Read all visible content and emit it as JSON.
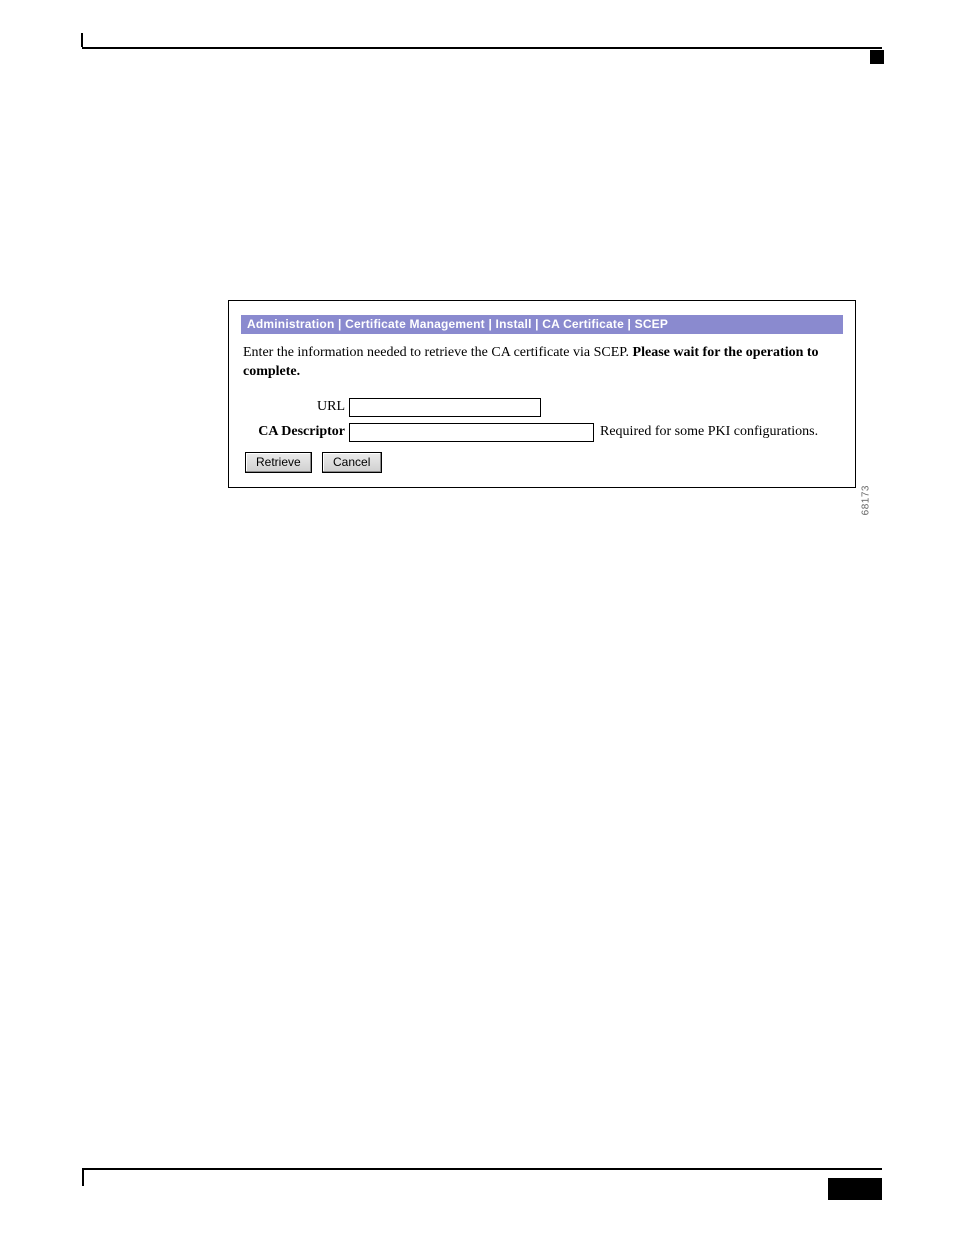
{
  "breadcrumb": {
    "parts": [
      "Administration",
      "Certificate Management",
      "Install",
      "CA Certificate",
      "SCEP"
    ],
    "separator": " | "
  },
  "intro": {
    "lead": "Enter the information needed to retrieve the CA certificate via SCEP. ",
    "bold": "Please wait for the operation to complete."
  },
  "form": {
    "url": {
      "label": "URL",
      "value": ""
    },
    "ca_descriptor": {
      "label": "CA Descriptor",
      "value": "",
      "hint": "Required for some PKI configurations."
    }
  },
  "buttons": {
    "retrieve": "Retrieve",
    "cancel": "Cancel"
  },
  "figure_id": "68173"
}
